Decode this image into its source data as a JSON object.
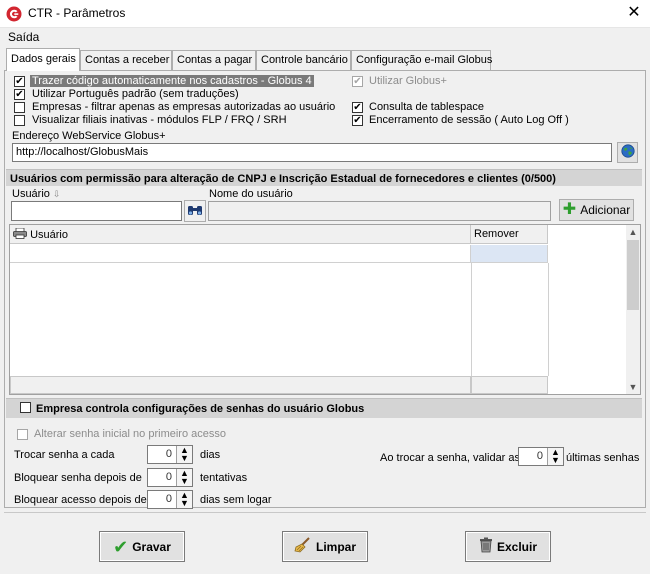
{
  "window": {
    "title": "CTR - Parâmetros",
    "close_glyph": "✕"
  },
  "menu": {
    "items": [
      "Saída"
    ]
  },
  "tabs": [
    "Dados gerais",
    "Contas a receber",
    "Contas a pagar",
    "Controle bancário",
    "Configuração e-mail Globus"
  ],
  "general": {
    "options_left": [
      {
        "label": "Trazer código automaticamente nos cadastros - Globus 4",
        "checked": true
      },
      {
        "label": "Utilizar Português padrão (sem traduções)",
        "checked": true
      },
      {
        "label": "Empresas - filtrar apenas as empresas autorizadas ao usuário",
        "checked": false
      },
      {
        "label": "Visualizar filiais inativas - módulos FLP / FRQ / SRH",
        "checked": false
      }
    ],
    "options_right": [
      {
        "label": "Utilizar Globus+",
        "checked": true,
        "disabled": true
      },
      {
        "label": "Consulta de tablespace",
        "checked": true
      },
      {
        "label": "Encerramento de sessão ( Auto Log Off )",
        "checked": true
      }
    ],
    "webservice_label": "Endereço WebService Globus+",
    "webservice_value": "http://localhost/GlobusMais"
  },
  "users_section": {
    "title": "Usuários com permissão para alteração de CNPJ e Inscrição Estadual de fornecedores e clientes (0/500)",
    "user_label": "Usuário",
    "user_name_label": "Nome do usuário",
    "user_value": "",
    "user_name_value": "",
    "add_button": "Adicionar",
    "grid_columns": [
      "Usuário",
      "Remover"
    ]
  },
  "password_section": {
    "title": "Empresa controla configurações de senhas do usuário Globus",
    "checked": false,
    "change_initial_label": "Alterar senha inicial no primeiro acesso",
    "change_every_label": "Trocar senha a cada",
    "change_every_value": "0",
    "change_every_unit": "dias",
    "lock_password_label": "Bloquear senha depois de",
    "lock_password_value": "0",
    "lock_password_unit": "tentativas",
    "lock_access_label": "Bloquear acesso depois de",
    "lock_access_value": "0",
    "lock_access_unit": "dias sem logar",
    "validate_label": "Ao trocar a senha, validar as",
    "validate_value": "0",
    "validate_unit": "últimas senhas"
  },
  "footer": {
    "save": "Gravar",
    "clear": "Limpar",
    "delete": "Excluir"
  },
  "colors": {
    "accent_logo": "#d22630",
    "check": "#000000"
  }
}
